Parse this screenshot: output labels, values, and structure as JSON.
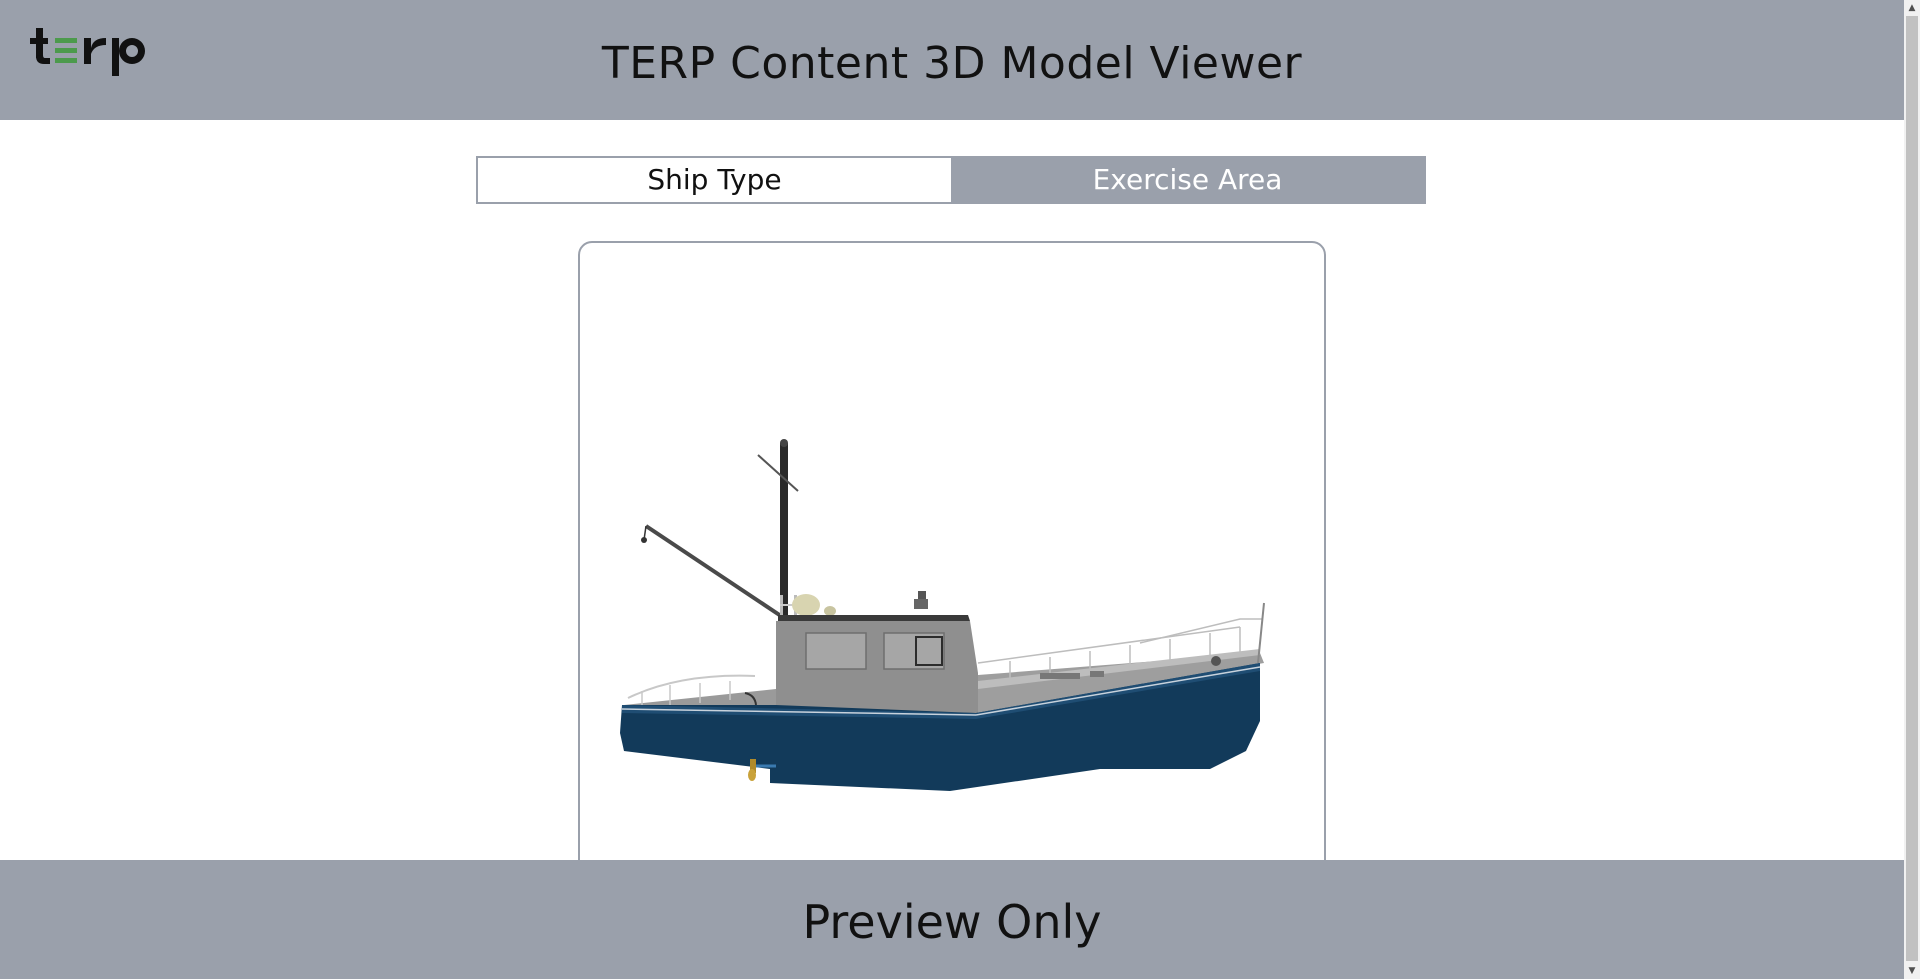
{
  "header": {
    "logo_text": "terp",
    "title": "TERP Content 3D Model Viewer"
  },
  "tabs": [
    {
      "label": "Ship Type",
      "active": true
    },
    {
      "label": "Exercise Area",
      "active": false
    }
  ],
  "viewer": {
    "model": "fishing-boat-icon"
  },
  "footer": {
    "text": "Preview Only"
  },
  "colors": {
    "header_bg": "#9aa0ab",
    "hull": "#123a5a",
    "superstructure": "#8f8f8f",
    "logo_accent": "#4c9a4c"
  }
}
